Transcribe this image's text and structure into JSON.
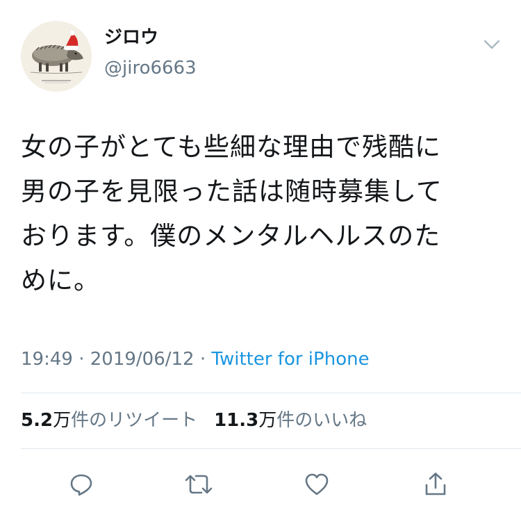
{
  "user": {
    "display_name": "ジロウ",
    "handle": "@jiro6663",
    "avatar_icon": "peccary-with-santa-hat-avatar"
  },
  "tweet": {
    "lines": [
      "女の子がとても些細な理由で残酷に",
      "男の子を見限った話は随時募集して",
      "おります。僕のメンタルヘルスのた",
      "めに。"
    ]
  },
  "meta": {
    "time": "19:49",
    "separator1": " · ",
    "date": "2019/06/12",
    "separator2": " · ",
    "source": "Twitter for iPhone"
  },
  "stats": {
    "retweets_number": "5.2",
    "retweets_unit": "万",
    "retweets_label": "件のリツイート",
    "likes_number": "11.3",
    "likes_unit": "万",
    "likes_label": "件のいいね"
  },
  "icons": {
    "menu": "chevron-down-icon",
    "reply": "reply-icon",
    "retweet": "retweet-icon",
    "like": "heart-icon",
    "share": "share-icon"
  },
  "colors": {
    "text": "#14171a",
    "secondary": "#657786",
    "link": "#1b95e0",
    "divider": "#e1e8ed",
    "icon": "#657786"
  }
}
